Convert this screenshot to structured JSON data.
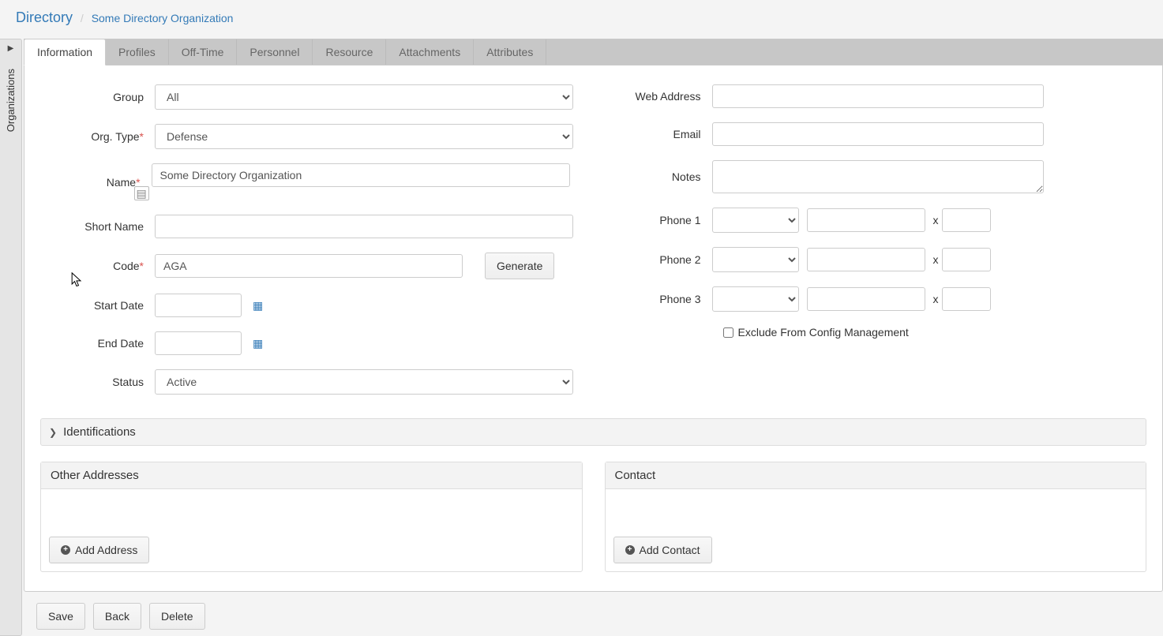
{
  "breadcrumb": {
    "main": "Directory",
    "sub": "Some Directory Organization"
  },
  "sidepanel": {
    "label": "Organizations"
  },
  "tabs": [
    "Information",
    "Profiles",
    "Off-Time",
    "Personnel",
    "Resource",
    "Attachments",
    "Attributes"
  ],
  "labels": {
    "group": "Group",
    "orgtype": "Org. Type",
    "name": "Name",
    "shortname": "Short Name",
    "code": "Code",
    "generate": "Generate",
    "startdate": "Start Date",
    "enddate": "End Date",
    "status": "Status",
    "web": "Web Address",
    "email": "Email",
    "notes": "Notes",
    "phone1": "Phone 1",
    "phone2": "Phone 2",
    "phone3": "Phone 3",
    "ext": "x",
    "exclude": "Exclude From Config Management",
    "identifications": "Identifications",
    "otheraddresses": "Other Addresses",
    "contact": "Contact",
    "addaddress": "Add Address",
    "addcontact": "Add Contact",
    "save": "Save",
    "back": "Back",
    "delete": "Delete"
  },
  "values": {
    "group": "All",
    "orgtype": "Defense",
    "name": "Some Directory Organization",
    "shortname": "",
    "code": "AGA",
    "startdate": "",
    "enddate": "",
    "status": "Active",
    "web": "",
    "email": "",
    "notes": "",
    "phone1_type": "",
    "phone1_num": "",
    "phone1_ext": "",
    "phone2_type": "",
    "phone2_num": "",
    "phone2_ext": "",
    "phone3_type": "",
    "phone3_num": "",
    "phone3_ext": ""
  }
}
